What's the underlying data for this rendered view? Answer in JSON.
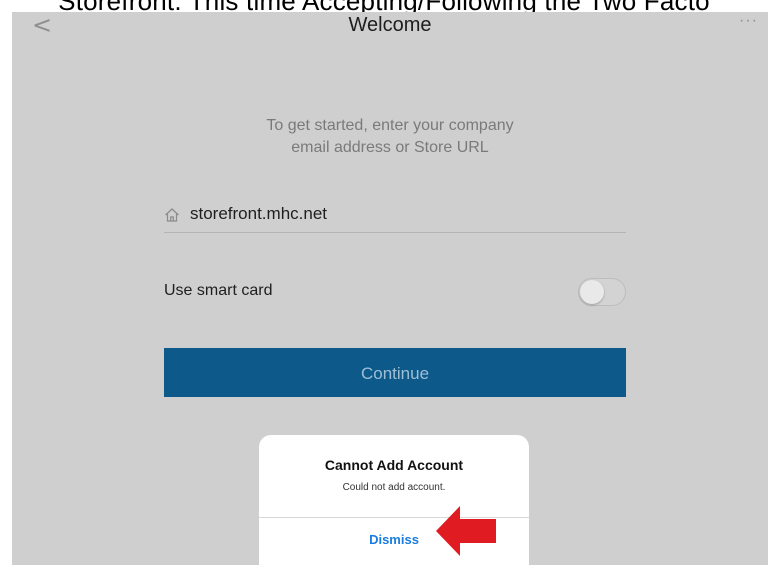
{
  "caption": "Storefront. This time Accepting/Following the Two Facto",
  "nav": {
    "back_glyph": "<",
    "title": "Welcome",
    "more_glyph": "···"
  },
  "intro": {
    "line1": "To get started, enter your company",
    "line2": "email address or Store URL"
  },
  "url_field": {
    "icon": "home-icon",
    "value": "storefront.mhc.net"
  },
  "smart_card": {
    "label": "Use smart card",
    "enabled": false
  },
  "continue_label": "Continue",
  "alert": {
    "title": "Cannot Add Account",
    "message": "Could not add account.",
    "dismiss_label": "Dismiss"
  },
  "colors": {
    "overlay_background": "#cfcfcf",
    "continue_button": "#0d5a8a",
    "dismiss_text": "#1a7de2",
    "annotation_arrow": "#e11b22"
  }
}
